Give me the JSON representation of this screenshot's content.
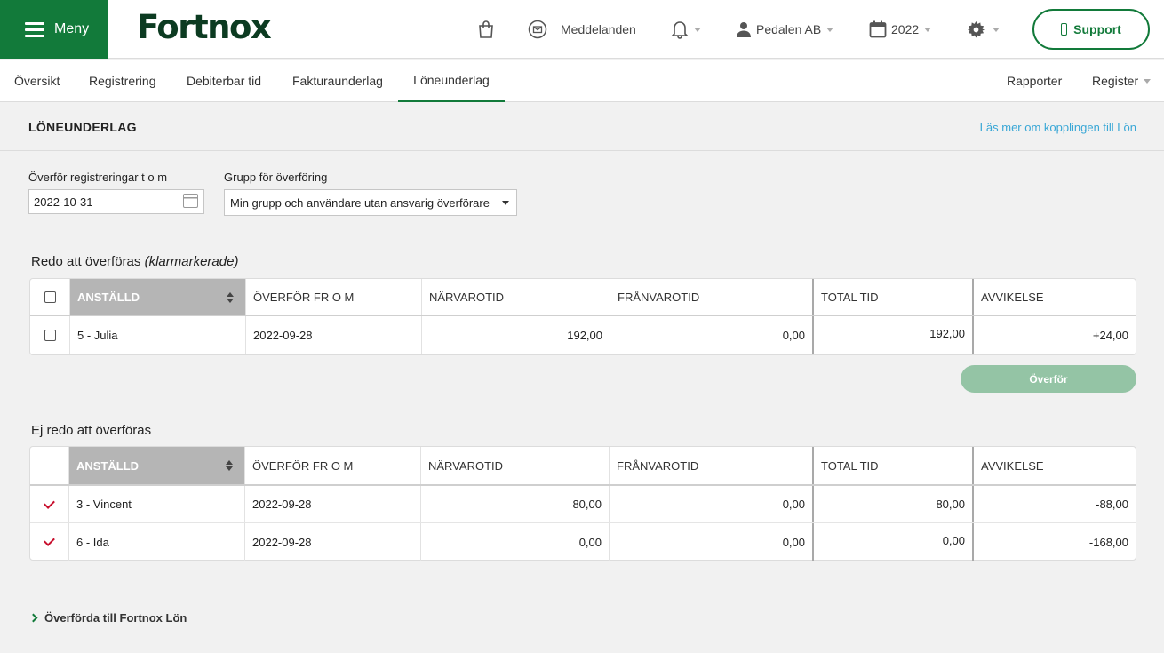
{
  "header": {
    "menu_label": "Meny",
    "logo_text": "Fortnox",
    "messages_label": "Meddelanden",
    "company_label": "Pedalen AB",
    "year_label": "2022",
    "support_label": "Support"
  },
  "nav": {
    "items": [
      "Översikt",
      "Registrering",
      "Debiterbar tid",
      "Fakturaunderlag",
      "Löneunderlag"
    ],
    "active": "Löneunderlag",
    "right_items": [
      "Rapporter",
      "Register"
    ]
  },
  "page": {
    "title": "LÖNEUNDERLAG",
    "info_link": "Läs mer om kopplingen till Lön"
  },
  "form": {
    "date_label": "Överför registreringar t o m",
    "date_value": "2022-10-31",
    "group_label": "Grupp för överföring",
    "group_value": "Min grupp och användare utan ansvarig överförare"
  },
  "ready": {
    "title_main": "Redo att överföras",
    "title_note": "(klarmarkerade)",
    "columns": [
      "ANSTÄLLD",
      "ÖVERFÖR FR O M",
      "NÄRVAROTID",
      "FRÅNVAROTID",
      "TOTAL TID",
      "AVVIKELSE"
    ],
    "rows": [
      {
        "employee": "5 - Julia",
        "from": "2022-09-28",
        "presence": "192,00",
        "absence": "0,00",
        "total": "192,00",
        "deviation": "+24,00"
      }
    ],
    "transfer_label": "Överför"
  },
  "not_ready": {
    "title": "Ej redo att överföras",
    "columns": [
      "ANSTÄLLD",
      "ÖVERFÖR FR O M",
      "NÄRVAROTID",
      "FRÅNVAROTID",
      "TOTAL TID",
      "AVVIKELSE"
    ],
    "rows": [
      {
        "employee": "3 - Vincent",
        "from": "2022-09-28",
        "presence": "80,00",
        "absence": "0,00",
        "total": "80,00",
        "deviation": "-88,00"
      },
      {
        "employee": "6 - Ida",
        "from": "2022-09-28",
        "presence": "0,00",
        "absence": "0,00",
        "total": "0,00",
        "deviation": "-168,00"
      }
    ]
  },
  "transferred": {
    "label": "Överförda till Fortnox Lön"
  },
  "colors": {
    "brand_green": "#127a3a",
    "logo_dark": "#0c3b21",
    "link_blue": "#39a7d6",
    "check_red": "#c8102e",
    "transfer_disabled": "#94c4a5"
  }
}
